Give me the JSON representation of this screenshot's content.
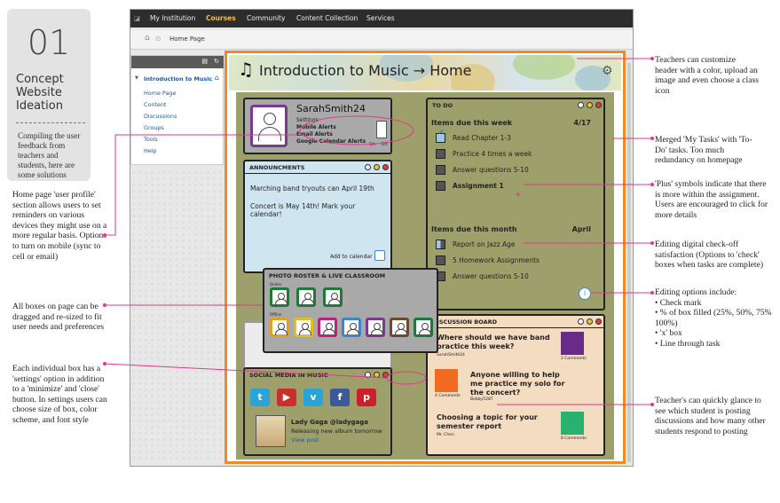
{
  "header": {
    "number": "01",
    "title": "Concept Website Ideation",
    "description": "Compiling the user feedback from teachers and students, here are some solutions"
  },
  "nav": {
    "items": [
      "My Institution",
      "Courses",
      "Community",
      "Content Collection",
      "Services"
    ],
    "active": "Courses"
  },
  "breadcrumb": "Home Page",
  "sidebar": {
    "course": "Introduction to Music",
    "items": [
      "Home Page",
      "Content",
      "Discussions",
      "Groups",
      "Tools",
      "Help"
    ]
  },
  "course_title": "Introduction to Music → Home",
  "profile": {
    "name": "SarahSmith24",
    "lines": [
      "Settings",
      "Mobile Alerts",
      "Email Alerts",
      "Google Calendar Alerts"
    ],
    "toggle": "On    Off"
  },
  "announcements": {
    "title": "ANNOUNCMENTS",
    "p1": "Marching band tryouts can April 19th",
    "p2": "Concert is May 14th! Mark your calendar!",
    "more": "Add to calendar"
  },
  "roster": {
    "title": "PHOTO ROSTER & LIVE CLASSROOM",
    "online": "Online",
    "offline": "Offline"
  },
  "todo": {
    "title": "TO DO",
    "week_label": "Items due this week",
    "week_date": "4/17",
    "week_items": [
      "Read Chapter 1-3",
      "Practice 4 times a week",
      "Answer questions 5-10",
      "Assignment 1"
    ],
    "month_label": "Items due this month",
    "month_date": "April",
    "month_items": [
      "Report on Jazz Age",
      "5 Homework Assignments",
      "Answer questions 5-10"
    ]
  },
  "discussion": {
    "title": "DISCUSSION BOARD",
    "posts": [
      {
        "title": "Where should we have band practice this week?",
        "author": "SarahSmith24",
        "meta": "2 Comments"
      },
      {
        "title": "Anyone willing to help me practice my solo for the concert?",
        "author": "Bobby5287",
        "meta": "4 Comments"
      },
      {
        "title": "Choosing a topic for your semester report",
        "author": "Mr. Chen",
        "meta": "8 Comments"
      }
    ]
  },
  "social": {
    "title": "SOCIAL MEDIA IN MUSIC",
    "tweet_name": "Lady Gaga @ladygaga",
    "tweet_text": "Releasing new album tomorrow",
    "tweet_link": "View post"
  },
  "notes": {
    "left1": "Home page 'user profile' section allows users to set reminders on various devices they might use on a more regular basis. Options to turn on mobile (sync to cell or email)",
    "left2": "All boxes on page can be dragged and re-sized to fit user needs and preferences",
    "left3": "Each individual box has a 'settings' option in addition to a 'minimize' and 'close' button. In settings users can choose size of box, color scheme, and font style",
    "right1": "Teachers can customize header with a color, upload an image and even choose a class icon",
    "right2": "Merged 'My Tasks' with 'To-Do' tasks. Too much redundancy on homepage",
    "right3": "'Plus' symbols indicate that there is more within the assignment. Users are encouraged to click for more details",
    "right4": "Editing digital check-off satisfaction (Options to 'check' boxes when tasks are complete)",
    "right5_title": "Editing options include:",
    "right5_items": [
      "Check mark",
      "% of box filled (25%, 50%, 75% 100%)",
      "'x' box",
      "Line through task"
    ],
    "right6": "Teacher's can quickly glance to see which student is posting discussions and how many other students respond to posting"
  },
  "colors": {
    "accent": "#f08a24",
    "annotation": "#e6358c",
    "todo_bg": "#9ea06b",
    "ann_bg": "#cfe6f0",
    "disc_bg": "#f4dcc0"
  }
}
